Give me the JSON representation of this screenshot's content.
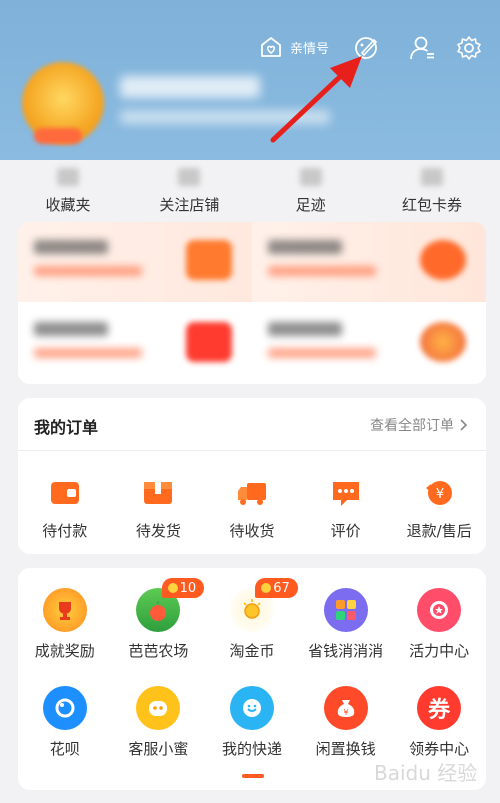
{
  "header": {
    "family_label": "亲情号",
    "icons": [
      "family-heart-icon",
      "skin-brush-icon",
      "account-manage-icon",
      "settings-gear-icon"
    ]
  },
  "stats": [
    {
      "label": "收藏夹"
    },
    {
      "label": "关注店铺"
    },
    {
      "label": "足迹"
    },
    {
      "label": "红包卡券"
    }
  ],
  "orders": {
    "title": "我的订单",
    "view_all": "查看全部订单",
    "items": [
      {
        "label": "待付款",
        "icon": "wallet-icon"
      },
      {
        "label": "待发货",
        "icon": "package-icon"
      },
      {
        "label": "待收货",
        "icon": "truck-icon"
      },
      {
        "label": "评价",
        "icon": "comment-icon"
      },
      {
        "label": "退款/售后",
        "icon": "refund-icon"
      }
    ]
  },
  "tools": {
    "row1": [
      {
        "label": "成就奖励",
        "icon": "trophy-icon"
      },
      {
        "label": "芭芭农场",
        "icon": "farm-icon",
        "badge": "10"
      },
      {
        "label": "淘金币",
        "icon": "gold-coin-icon",
        "badge": "67"
      },
      {
        "label": "省钱消消消",
        "icon": "puzzle-game-icon"
      },
      {
        "label": "活力中心",
        "icon": "medal-icon"
      }
    ],
    "row2": [
      {
        "label": "花呗",
        "icon": "huabei-icon"
      },
      {
        "label": "客服小蜜",
        "icon": "customer-service-icon"
      },
      {
        "label": "我的快递",
        "icon": "courier-icon"
      },
      {
        "label": "闲置换钱",
        "icon": "money-bag-icon"
      },
      {
        "label": "领券中心",
        "icon": "coupon-icon",
        "glyph": "券"
      }
    ]
  },
  "colors": {
    "header_bg": "#7fb1d9",
    "accent": "#ff5a1f",
    "arrow": "#e8201c"
  },
  "watermark": "Baidu 经验"
}
